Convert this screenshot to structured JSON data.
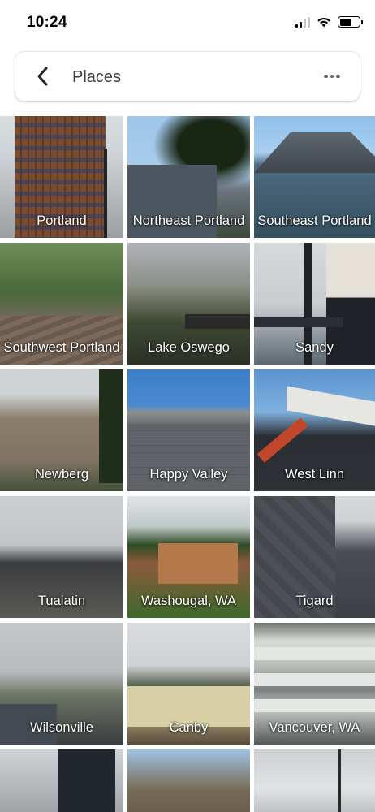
{
  "status_bar": {
    "time": "10:24",
    "icons": [
      "signal-icon",
      "wifi-icon",
      "battery-icon"
    ],
    "battery_level": 0.62
  },
  "topbar": {
    "title": "Places",
    "back_icon": "chevron-left-icon",
    "menu_icon": "more-horizontal-icon"
  },
  "places": [
    {
      "label": "Portland"
    },
    {
      "label": "Northeast Portland"
    },
    {
      "label": "Southeast Portland"
    },
    {
      "label": "Southwest Portland"
    },
    {
      "label": "Lake Oswego"
    },
    {
      "label": "Sandy"
    },
    {
      "label": "Newberg"
    },
    {
      "label": "Happy Valley"
    },
    {
      "label": "West Linn"
    },
    {
      "label": "Tualatin"
    },
    {
      "label": "Washougal, WA"
    },
    {
      "label": "Tigard"
    },
    {
      "label": "Wilsonville"
    },
    {
      "label": "Canby"
    },
    {
      "label": "Vancouver, WA"
    }
  ],
  "colors": {
    "topbar_text": "#3c4043",
    "icon_gray": "#5f6368",
    "label_text": "#ffffff"
  }
}
